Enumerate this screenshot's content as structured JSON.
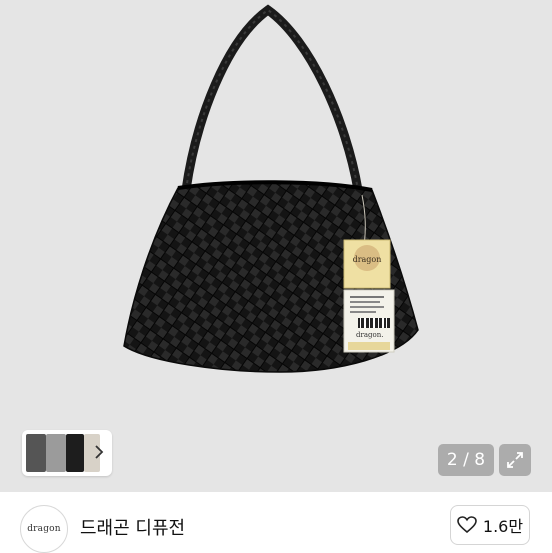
{
  "gallery": {
    "image_alt": "black woven leather shoulder bag",
    "page_counter": "2 / 8",
    "tag_brand_text": "dragon",
    "tag_label_text": "dragon."
  },
  "seller": {
    "avatar_text": "dragon",
    "name": "드래곤 디퓨전"
  },
  "like": {
    "count": "1.6만"
  },
  "icons": {
    "thumb_next": "chevron-right-icon",
    "expand": "expand-icon",
    "like": "heart-outline-icon"
  }
}
